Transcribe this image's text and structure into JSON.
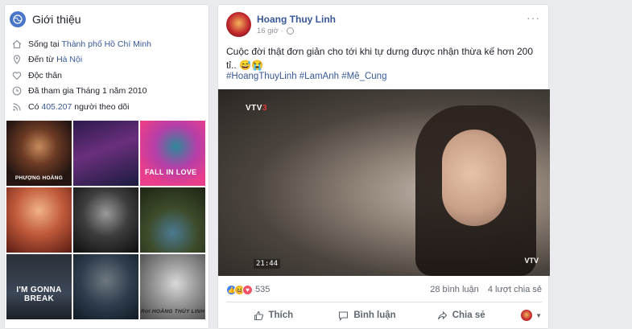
{
  "intro": {
    "title": "Giới thiệu",
    "lives_prefix": "Sống tại",
    "lives_city": "Thành phố Hồ Chí Minh",
    "from_prefix": "Đến từ",
    "from_city": "Hà Nội",
    "relationship": "Độc thân",
    "joined": "Đã tham gia Tháng 1 năm 2010",
    "followers_prefix": "Có",
    "followers_count": "405.207",
    "followers_suffix": "người theo dõi",
    "photo_captions": [
      "PHƯỢNG HOÀNG",
      "",
      "FALL IN LOVE",
      "",
      "",
      "",
      "I'M GONNA BREAK",
      "",
      "Rời HOÀNG THÙY LINH"
    ]
  },
  "post": {
    "author": "Hoang Thuy Linh",
    "time": "16 giờ ·",
    "text": "Cuộc đời thật đơn giản cho tới khi tự dưng được nhận thừa kế hơn 200 tỉ.. 😅😭",
    "hashtags": "#HoangThuyLinh #LamAnh #Mê_Cung",
    "more": "···",
    "video": {
      "channel": "VTV",
      "channel_num": "3",
      "timestamp": "21:44",
      "corner_logo": "VTV"
    },
    "reactions_count": "535",
    "comments": "28 bình luận",
    "shares": "4 lượt chia sẻ",
    "actions": {
      "like": "Thích",
      "comment": "Bình luận",
      "share": "Chia sẻ"
    }
  },
  "colors": {
    "link": "#385898",
    "background": "#e9ebee",
    "muted": "#90949c"
  }
}
